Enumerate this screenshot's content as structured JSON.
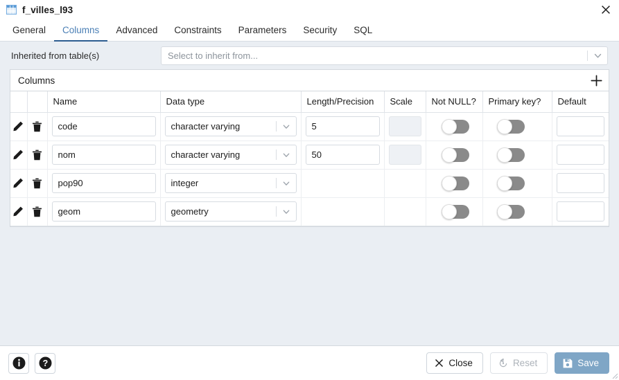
{
  "window": {
    "title": "f_villes_l93",
    "title_icon": "table-icon",
    "close_icon": "close-icon"
  },
  "tabs": [
    {
      "label": "General",
      "active": false
    },
    {
      "label": "Columns",
      "active": true
    },
    {
      "label": "Advanced",
      "active": false
    },
    {
      "label": "Constraints",
      "active": false
    },
    {
      "label": "Parameters",
      "active": false
    },
    {
      "label": "Security",
      "active": false
    },
    {
      "label": "SQL",
      "active": false
    }
  ],
  "inherit": {
    "label": "Inherited from table(s)",
    "placeholder": "Select to inherit from...",
    "value": "",
    "chevron_icon": "chevron-down-icon"
  },
  "columns_panel": {
    "title": "Columns",
    "add_icon": "plus-icon",
    "headers": [
      "",
      "",
      "Name",
      "Data type",
      "Length/Precision",
      "Scale",
      "Not NULL?",
      "Primary key?",
      "Default"
    ],
    "rows": [
      {
        "edit_icon": "pencil-icon",
        "delete_icon": "trash-icon",
        "name": "code",
        "data_type": "character varying",
        "length": "5",
        "scale": "",
        "scale_disabled": true,
        "not_null": false,
        "primary_key": false,
        "default": ""
      },
      {
        "edit_icon": "pencil-icon",
        "delete_icon": "trash-icon",
        "name": "nom",
        "data_type": "character varying",
        "length": "50",
        "scale": "",
        "scale_disabled": true,
        "not_null": false,
        "primary_key": false,
        "default": ""
      },
      {
        "edit_icon": "pencil-icon",
        "delete_icon": "trash-icon",
        "name": "pop90",
        "data_type": "integer",
        "length": "",
        "scale": "",
        "scale_disabled": false,
        "not_null": false,
        "primary_key": false,
        "default": ""
      },
      {
        "edit_icon": "pencil-icon",
        "delete_icon": "trash-icon",
        "name": "geom",
        "data_type": "geometry",
        "length": "",
        "scale": "",
        "scale_disabled": false,
        "not_null": false,
        "primary_key": false,
        "default": ""
      }
    ]
  },
  "footer": {
    "info_icon": "info-icon",
    "help_icon": "help-icon",
    "close_label": "Close",
    "close_icon": "close-x-icon",
    "reset_label": "Reset",
    "reset_icon": "reset-icon",
    "reset_disabled": true,
    "save_label": "Save",
    "save_icon": "save-disk-icon"
  },
  "colors": {
    "page_background": "#eaeef3",
    "panel_background": "#ffffff",
    "active_tab_text": "#4a7fb5",
    "active_tab_underline": "#2c5c8f",
    "save_button": "#7fa6c6",
    "toggle_off_track": "#8a8a8a",
    "disabled_input": "#eef1f5",
    "placeholder_text": "#8d949c"
  }
}
